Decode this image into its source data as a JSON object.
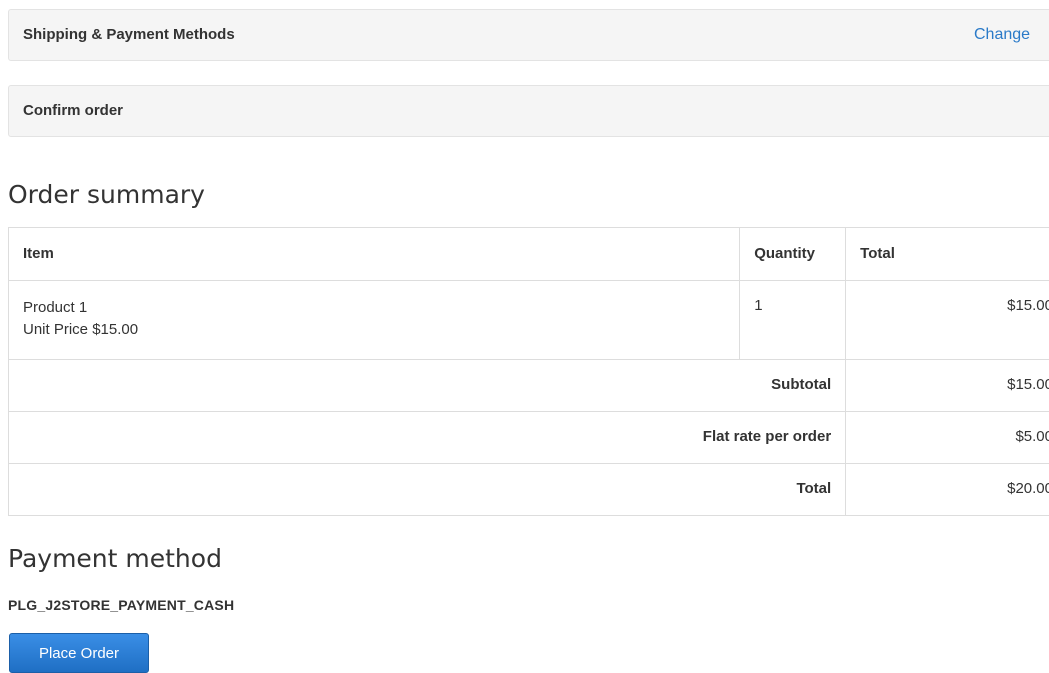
{
  "checkout_steps": {
    "shipping_payment": {
      "title": "Shipping & Payment Methods",
      "change_link": "Change"
    },
    "confirm_order": {
      "title": "Confirm order"
    }
  },
  "order_summary": {
    "heading": "Order summary",
    "columns": {
      "item": "Item",
      "quantity": "Quantity",
      "total": "Total"
    },
    "items": [
      {
        "name": "Product 1",
        "unit_price_label": "Unit Price",
        "unit_price": "$15.00",
        "quantity": "1",
        "total": "$15.00"
      }
    ],
    "totals": [
      {
        "label": "Subtotal",
        "value": "$15.00"
      },
      {
        "label": "Flat rate per order",
        "value": "$5.00"
      },
      {
        "label": "Total",
        "value": "$20.00"
      }
    ]
  },
  "payment": {
    "heading": "Payment method",
    "method_code": "PLG_J2STORE_PAYMENT_CASH",
    "place_order_label": "Place Order"
  },
  "colors": {
    "link": "#2a7ac8",
    "primary_button": "#2a7ed6",
    "panel_background": "#f5f5f5"
  }
}
